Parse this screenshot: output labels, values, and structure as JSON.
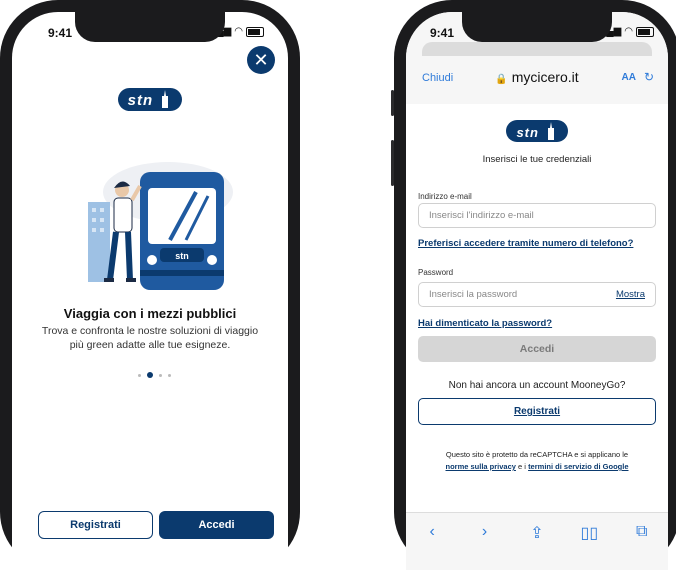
{
  "left_phone": {
    "status_time": "9:41",
    "logo_text": "stn",
    "illustration": "bus-and-person-illustration",
    "title": "Viaggia con i mezzi pubblici",
    "description_line1": "Trova e confronta le nostre soluzioni di viaggio",
    "description_line2": "più green adatte alle tue esigneze.",
    "pagination": {
      "total": 4,
      "active": 2
    },
    "register_label": "Registrati",
    "login_label": "Accedi"
  },
  "right_phone": {
    "status_time": "9:41",
    "browser": {
      "close_label": "Chiudi",
      "url": "mycicero.it",
      "text_size_label": "AA"
    },
    "logo_text": "stn",
    "heading": "Inserisci le tue credenziali",
    "email_label": "Indirizzo e-mail",
    "email_placeholder": "Inserisci l'indirizzo e-mail",
    "phone_login_link": "Preferisci accedere tramite numero di telefono?",
    "password_label": "Password",
    "password_placeholder": "Inserisci la password",
    "show_password_label": "Mostra",
    "forgot_password_link": "Hai dimenticato la password?",
    "login_label": "Accedi",
    "no_account_text": "Non hai ancora un account MooneyGo?",
    "register_label": "Registrati",
    "recaptcha_text": "Questo sito è protetto da reCAPTCHA e si applicano le",
    "privacy_link": "norme sulla privacy",
    "and_text": "e i",
    "terms_link": "termini di servizio di Google"
  },
  "colors": {
    "brand": "#0b3a6e",
    "link_blue": "#2f7bd9",
    "disabled_bg": "#d6d6d6",
    "phone_frame": "#1b1b1d"
  }
}
